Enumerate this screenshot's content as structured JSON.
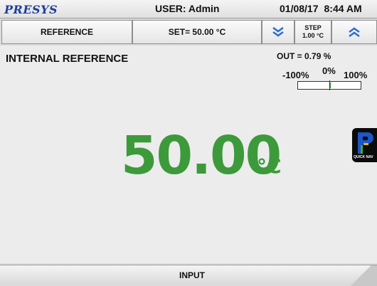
{
  "header": {
    "logo": "PRESYS",
    "user": "USER: Admin",
    "date": "01/08/17",
    "time": "8:44 AM"
  },
  "controls": {
    "reference_label": "REFERENCE",
    "setpoint_label": "SET= 50.00 °C",
    "step_title": "STEP",
    "step_value": "1.00 °C",
    "down_icon": "double-chevron-down-icon",
    "up_icon": "double-chevron-up-icon"
  },
  "panel": {
    "title": "INTERNAL REFERENCE",
    "output": "OUT = 0.79 %",
    "output_percent": 0.79,
    "bar_min_label": "-100%",
    "bar_mid_label": "0%",
    "bar_max_label": "100%",
    "value": "50.00",
    "unit": "°C",
    "quick_nav_label": "QUICK NAV"
  },
  "footer": {
    "label": "INPUT"
  },
  "colors": {
    "value_green": "#3c9a3a",
    "logo_blue": "#1e3f9a",
    "chevron_blue": "#2f6fd0"
  }
}
